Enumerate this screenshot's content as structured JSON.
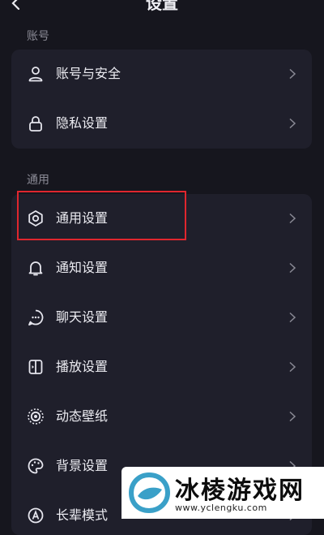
{
  "header": {
    "title": "设置",
    "back_icon": "chevron-left-icon"
  },
  "sections": [
    {
      "label": "账号",
      "items": [
        {
          "label": "账号与安全",
          "icon": "person-icon"
        },
        {
          "label": "隐私设置",
          "icon": "lock-icon"
        }
      ]
    },
    {
      "label": "通用",
      "items": [
        {
          "label": "通用设置",
          "icon": "gear-icon"
        },
        {
          "label": "通知设置",
          "icon": "bell-icon"
        },
        {
          "label": "聊天设置",
          "icon": "chat-icon"
        },
        {
          "label": "播放设置",
          "icon": "play-icon"
        },
        {
          "label": "动态壁纸",
          "icon": "wallpaper-icon"
        },
        {
          "label": "背景设置",
          "icon": "palette-icon"
        },
        {
          "label": "长辈模式",
          "icon": "elder-mode-icon"
        }
      ]
    }
  ],
  "highlighted_item": "通用设置",
  "colors": {
    "background": "#16161e",
    "card": "#1f1f2b",
    "highlight": "#e0262e",
    "watermark_logo": "#3aa0c8"
  },
  "watermark": {
    "title": "冰棱游戏网",
    "url": "www.yclengku.com"
  }
}
